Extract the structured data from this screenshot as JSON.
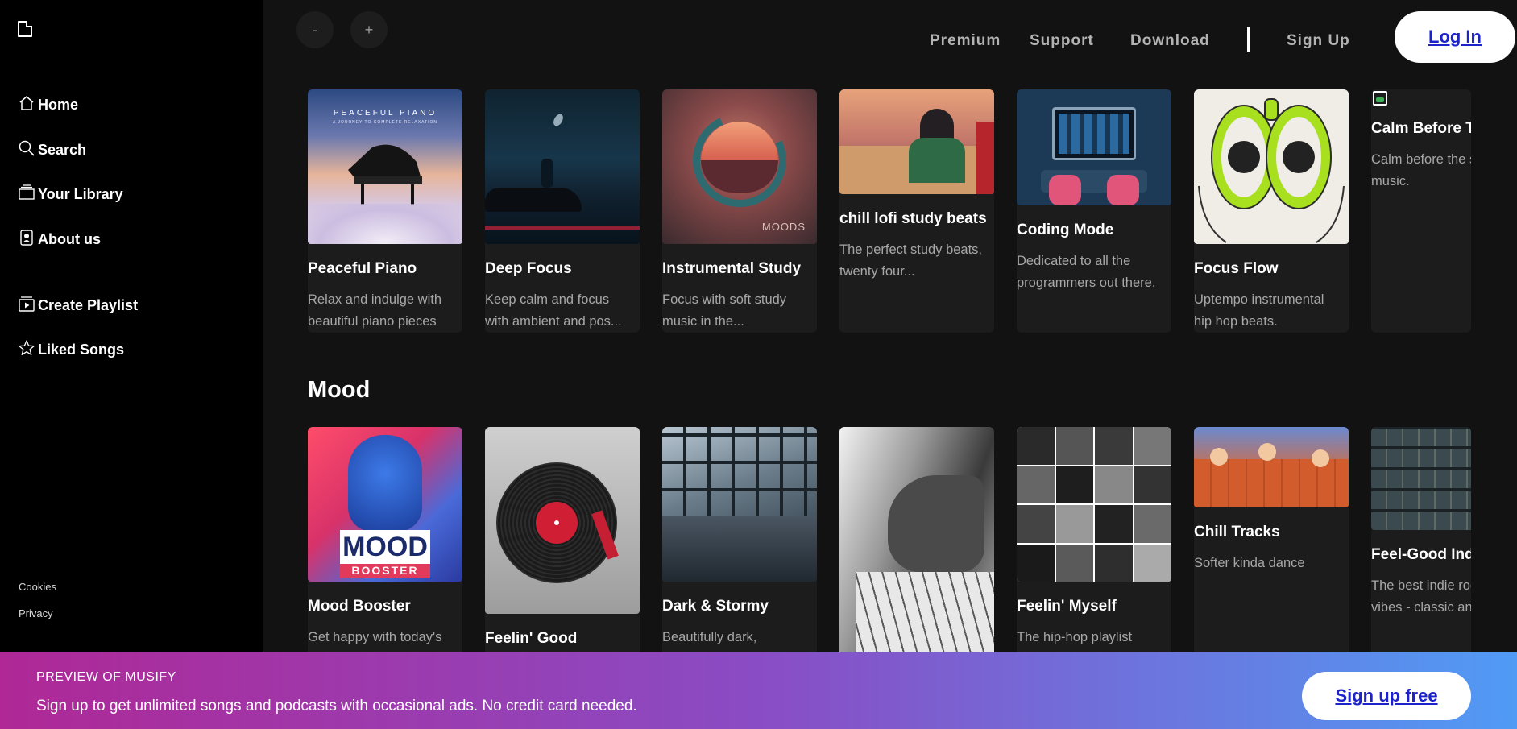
{
  "sidebar": {
    "nav": [
      {
        "label": "Home",
        "icon": "home-icon"
      },
      {
        "label": "Search",
        "icon": "search-icon"
      },
      {
        "label": "Your Library",
        "icon": "library-icon"
      },
      {
        "label": "About us",
        "icon": "about-icon"
      }
    ],
    "actions": [
      {
        "label": "Create Playlist",
        "icon": "create-playlist-icon"
      },
      {
        "label": "Liked Songs",
        "icon": "star-icon"
      }
    ],
    "footer": [
      "Cookies",
      "Privacy"
    ]
  },
  "topbar": {
    "back_label": "-",
    "forward_label": "+",
    "links": [
      "Premium",
      "Support",
      "Download"
    ],
    "signup_label": "Sign Up",
    "login_label": "Log In"
  },
  "focus": {
    "cards": [
      {
        "title": "Peaceful Piano",
        "desc": "Relax and indulge with beautiful piano pieces"
      },
      {
        "title": "Deep Focus",
        "desc": "Keep calm and focus with ambient and pos..."
      },
      {
        "title": "Instrumental Study",
        "desc": "Focus with soft study music in the..."
      },
      {
        "title": "chill lofi study beats",
        "desc": "The perfect study beats, twenty four..."
      },
      {
        "title": "Coding Mode",
        "desc": "Dedicated to all the programmers out there."
      },
      {
        "title": "Focus Flow",
        "desc": "Uptempo instrumental hip hop beats."
      },
      {
        "title": "Calm Before The Storm",
        "desc": "Calm before the storm music."
      }
    ],
    "art_text": {
      "peaceful_piano": "PEACEFUL PIANO",
      "peaceful_piano_sub": "A JOURNEY TO COMPLETE RELAXATION",
      "moods": "MOODS"
    }
  },
  "mood": {
    "title": "Mood",
    "cards": [
      {
        "title": "Mood Booster",
        "desc": "Get happy with today's"
      },
      {
        "title": "Feelin' Good",
        "desc": ""
      },
      {
        "title": "Dark & Stormy",
        "desc": "Beautifully dark,"
      },
      {
        "title": "",
        "desc": ""
      },
      {
        "title": "Feelin' Myself",
        "desc": "The hip-hop playlist"
      },
      {
        "title": "Chill Tracks",
        "desc": "Softer kinda dance"
      },
      {
        "title": "Feel-Good Indie",
        "desc": "The best indie rock vibes - classic and"
      }
    ],
    "art_text": {
      "mood": "MOOD",
      "booster": "BOOSTER"
    }
  },
  "banner": {
    "preview": "PREVIEW OF MUSIFY",
    "message": "Sign up to get unlimited songs and podcasts with occasional ads. No credit card needed.",
    "cta": "Sign up free"
  }
}
